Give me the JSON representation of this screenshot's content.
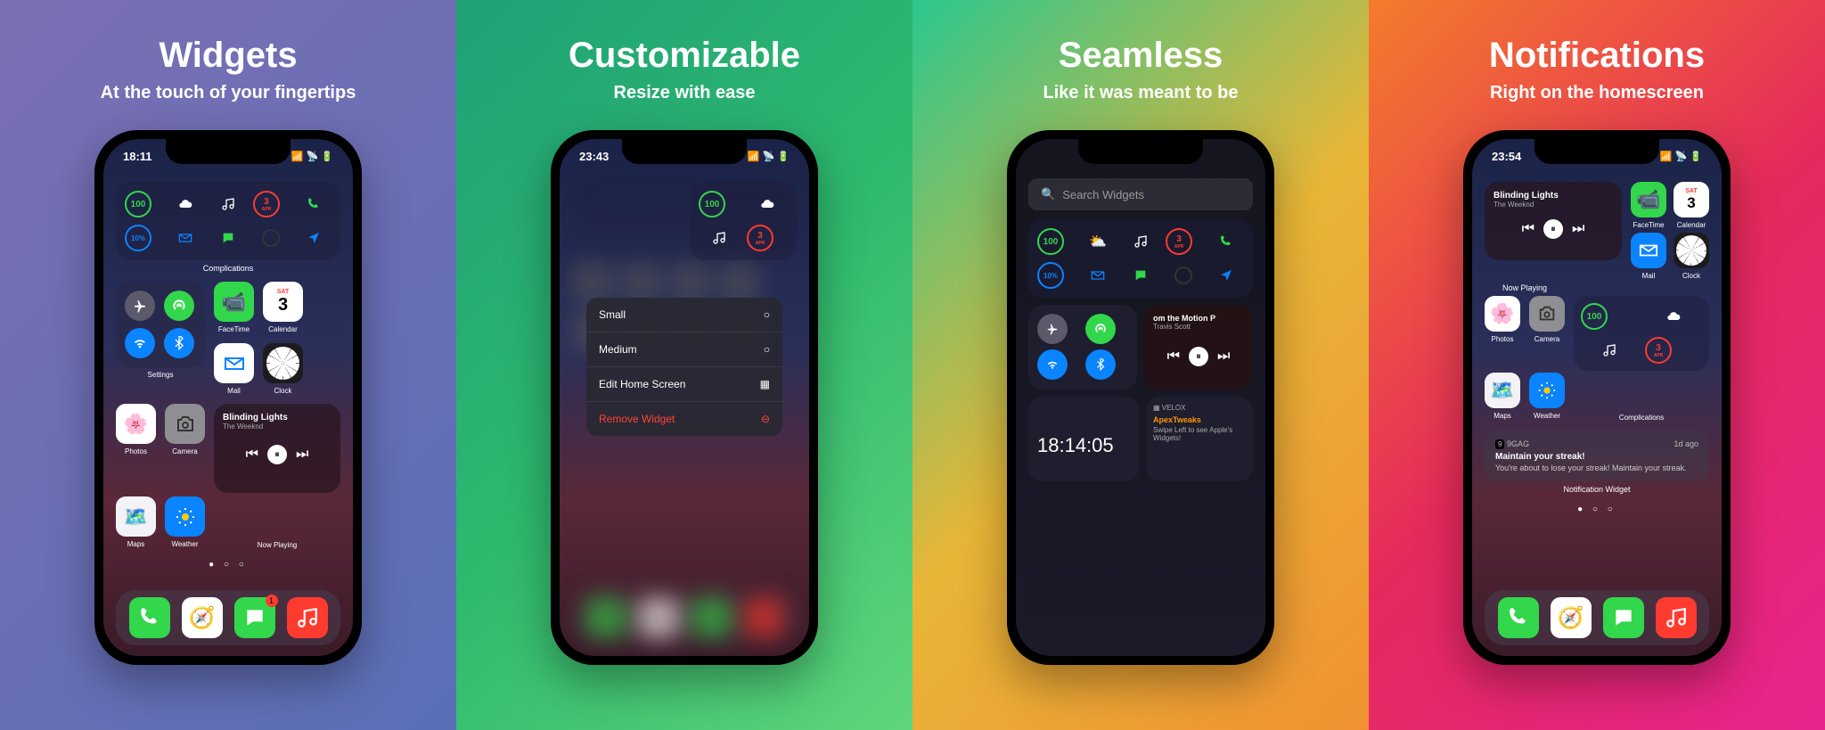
{
  "panels": [
    {
      "title": "Widgets",
      "sub": "At the touch of your fingertips"
    },
    {
      "title": "Customizable",
      "sub": "Resize with ease"
    },
    {
      "title": "Seamless",
      "sub": "Like it was meant to be"
    },
    {
      "title": "Notifications",
      "sub": "Right on the homescreen"
    }
  ],
  "p1": {
    "time": "18:11",
    "comp": {
      "battery": "100",
      "date_day": "3",
      "date_mon": "APR",
      "pct": "10%",
      "label": "Complications"
    },
    "conn_label": "Settings",
    "apps_r1": [
      {
        "label": "FaceTime",
        "bg": "#32d74b"
      },
      {
        "label": "Calendar",
        "bg": "#fff"
      }
    ],
    "apps_r2": [
      {
        "label": "Mail",
        "bg": "#fff"
      },
      {
        "label": "Clock",
        "bg": "#1c1c1e"
      }
    ],
    "apps_r3": [
      {
        "label": "Photos",
        "bg": "#fff"
      },
      {
        "label": "Camera",
        "bg": "#8e8e93"
      }
    ],
    "apps_r4": [
      {
        "label": "Maps",
        "bg": "#f2f2f7"
      },
      {
        "label": "Weather",
        "bg": "#0a84ff"
      }
    ],
    "music": {
      "title": "Blinding Lights",
      "artist": "The Weeknd",
      "label": "Now Playing"
    },
    "cal": {
      "day": "SAT",
      "num": "3"
    }
  },
  "p2": {
    "time": "23:43",
    "comp": {
      "battery": "100",
      "date_day": "3",
      "date_mon": "APR"
    },
    "menu": [
      {
        "label": "Small",
        "type": "radio"
      },
      {
        "label": "Medium",
        "type": "radio"
      },
      {
        "label": "Edit Home Screen",
        "type": "action"
      },
      {
        "label": "Remove Widget",
        "type": "danger"
      }
    ]
  },
  "p3": {
    "search": "Search Widgets",
    "comp": {
      "battery": "100",
      "date_day": "3",
      "date_mon": "APR",
      "pct": "10%"
    },
    "music": {
      "title": "om the Motion P",
      "artist": "Travis Scott"
    },
    "velox": {
      "brand": "VELOX",
      "head": "ApexTweaks",
      "body": "Swipe Left to see Apple's Widgets!"
    },
    "clock": "18:14:05"
  },
  "p4": {
    "time": "23:54",
    "music": {
      "title": "Blinding Lights",
      "artist": "The Weeknd",
      "label": "Now Playing"
    },
    "apps_r1": [
      {
        "label": "FaceTime",
        "bg": "#32d74b"
      },
      {
        "label": "Calendar",
        "bg": "#fff"
      }
    ],
    "apps_r2": [
      {
        "label": "Mail",
        "bg": "#0a84ff"
      },
      {
        "label": "Clock",
        "bg": "#1c1c1e"
      }
    ],
    "apps_r3": [
      {
        "label": "Photos",
        "bg": "#fff"
      },
      {
        "label": "Camera",
        "bg": "#8e8e93"
      }
    ],
    "apps_r4": [
      {
        "label": "Maps",
        "bg": "#f2f2f7"
      },
      {
        "label": "Weather",
        "bg": "#0a84ff"
      }
    ],
    "comp": {
      "battery": "100",
      "date_day": "3",
      "date_mon": "APR",
      "label": "Complications"
    },
    "cal": {
      "day": "SAT",
      "num": "3"
    },
    "notif": {
      "app": "9GAG",
      "time": "1d ago",
      "title": "Maintain your streak!",
      "body": "You're about to lose your streak! Maintain your streak.",
      "label": "Notification Widget"
    }
  },
  "dock_badge": "1"
}
